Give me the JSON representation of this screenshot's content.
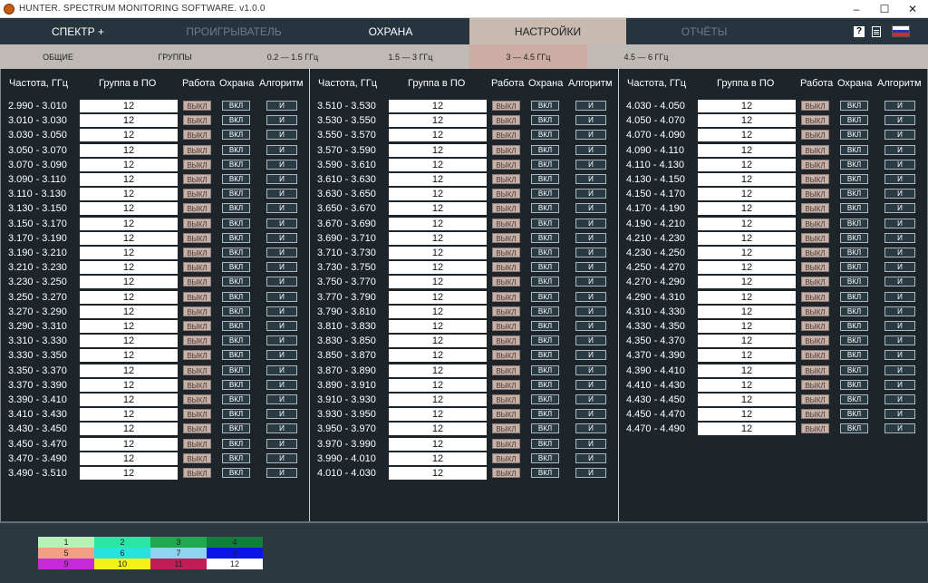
{
  "window": {
    "title": "HUNTER. SPECTRUM MONITORING SOFTWARE. v1.0.0",
    "controls": [
      "–",
      "☐",
      "✕"
    ]
  },
  "nav": {
    "tabs": [
      "СПЕКТР +",
      "ПРОИГРЫВАТЕЛЬ",
      "ОХРАНА",
      "НАСТРОЙКИ",
      "ОТЧЁТЫ"
    ],
    "active": "НАСТРОЙКИ",
    "help": "?"
  },
  "subnav": {
    "tabs": [
      "ОБЩИЕ",
      "ГРУППЫ",
      "0.2 — 1.5 ГГц",
      "1.5 — 3 ГГц",
      "3 — 4.5 ГГц",
      "4.5 — 6 ГГц"
    ],
    "active": "3 — 4.5 ГГц"
  },
  "table": {
    "headers": [
      "Частота, ГГц",
      "Группа в ПО",
      "Работа",
      "Охрана",
      "Алгоритм"
    ],
    "button_labels": {
      "work": "ВЫКЛ",
      "guard": "ВКЛ",
      "algorithm": "И"
    },
    "columns": [
      [
        {
          "freq": "2.990 - 3.010",
          "group": "12"
        },
        {
          "freq": "3.010 - 3.030",
          "group": "12"
        },
        {
          "freq": "3.030 - 3.050",
          "group": "12"
        },
        {
          "freq": "3.050 - 3.070",
          "group": "12"
        },
        {
          "freq": "3.070 - 3.090",
          "group": "12"
        },
        {
          "freq": "3.090 - 3.110",
          "group": "12"
        },
        {
          "freq": "3.110 - 3.130",
          "group": "12"
        },
        {
          "freq": "3.130 - 3.150",
          "group": "12"
        },
        {
          "freq": "3.150 - 3.170",
          "group": "12"
        },
        {
          "freq": "3.170 - 3.190",
          "group": "12"
        },
        {
          "freq": "3.190 - 3.210",
          "group": "12"
        },
        {
          "freq": "3.210 - 3.230",
          "group": "12"
        },
        {
          "freq": "3.230 - 3.250",
          "group": "12"
        },
        {
          "freq": "3.250 - 3.270",
          "group": "12"
        },
        {
          "freq": "3.270 - 3.290",
          "group": "12"
        },
        {
          "freq": "3.290 - 3.310",
          "group": "12"
        },
        {
          "freq": "3.310 - 3.330",
          "group": "12"
        },
        {
          "freq": "3.330 - 3.350",
          "group": "12"
        },
        {
          "freq": "3.350 - 3.370",
          "group": "12"
        },
        {
          "freq": "3.370 - 3.390",
          "group": "12"
        },
        {
          "freq": "3.390 - 3.410",
          "group": "12"
        },
        {
          "freq": "3.410 - 3.430",
          "group": "12"
        },
        {
          "freq": "3.430 - 3.450",
          "group": "12"
        },
        {
          "freq": "3.450 - 3.470",
          "group": "12"
        },
        {
          "freq": "3.470 - 3.490",
          "group": "12"
        },
        {
          "freq": "3.490 - 3.510",
          "group": "12"
        }
      ],
      [
        {
          "freq": "3.510 - 3.530",
          "group": "12"
        },
        {
          "freq": "3.530 - 3.550",
          "group": "12"
        },
        {
          "freq": "3.550 - 3.570",
          "group": "12"
        },
        {
          "freq": "3.570 - 3.590",
          "group": "12"
        },
        {
          "freq": "3.590 - 3.610",
          "group": "12"
        },
        {
          "freq": "3.610 - 3.630",
          "group": "12"
        },
        {
          "freq": "3.630 - 3.650",
          "group": "12"
        },
        {
          "freq": "3.650 - 3.670",
          "group": "12"
        },
        {
          "freq": "3.670 - 3.690",
          "group": "12"
        },
        {
          "freq": "3.690 - 3.710",
          "group": "12"
        },
        {
          "freq": "3.710 - 3.730",
          "group": "12"
        },
        {
          "freq": "3.730 - 3.750",
          "group": "12"
        },
        {
          "freq": "3.750 - 3.770",
          "group": "12"
        },
        {
          "freq": "3.770 - 3.790",
          "group": "12"
        },
        {
          "freq": "3.790 - 3.810",
          "group": "12"
        },
        {
          "freq": "3.810 - 3.830",
          "group": "12"
        },
        {
          "freq": "3.830 - 3.850",
          "group": "12"
        },
        {
          "freq": "3.850 - 3.870",
          "group": "12"
        },
        {
          "freq": "3.870 - 3.890",
          "group": "12"
        },
        {
          "freq": "3.890 - 3.910",
          "group": "12"
        },
        {
          "freq": "3.910 - 3.930",
          "group": "12"
        },
        {
          "freq": "3.930 - 3.950",
          "group": "12"
        },
        {
          "freq": "3.950 - 3.970",
          "group": "12"
        },
        {
          "freq": "3.970 - 3.990",
          "group": "12"
        },
        {
          "freq": "3.990 - 4.010",
          "group": "12"
        },
        {
          "freq": "4.010 - 4.030",
          "group": "12"
        }
      ],
      [
        {
          "freq": "4.030 - 4.050",
          "group": "12"
        },
        {
          "freq": "4.050 - 4.070",
          "group": "12"
        },
        {
          "freq": "4.070 - 4.090",
          "group": "12"
        },
        {
          "freq": "4.090 - 4.110",
          "group": "12"
        },
        {
          "freq": "4.110 - 4.130",
          "group": "12"
        },
        {
          "freq": "4.130 - 4.150",
          "group": "12"
        },
        {
          "freq": "4.150 - 4.170",
          "group": "12"
        },
        {
          "freq": "4.170 - 4.190",
          "group": "12"
        },
        {
          "freq": "4.190 - 4.210",
          "group": "12"
        },
        {
          "freq": "4.210 - 4.230",
          "group": "12"
        },
        {
          "freq": "4.230 - 4.250",
          "group": "12"
        },
        {
          "freq": "4.250 - 4.270",
          "group": "12"
        },
        {
          "freq": "4.270 - 4.290",
          "group": "12"
        },
        {
          "freq": "4.290 - 4.310",
          "group": "12"
        },
        {
          "freq": "4.310 - 4.330",
          "group": "12"
        },
        {
          "freq": "4.330 - 4.350",
          "group": "12"
        },
        {
          "freq": "4.350 - 4.370",
          "group": "12"
        },
        {
          "freq": "4.370 - 4.390",
          "group": "12"
        },
        {
          "freq": "4.390 - 4.410",
          "group": "12"
        },
        {
          "freq": "4.410 - 4.430",
          "group": "12"
        },
        {
          "freq": "4.430 - 4.450",
          "group": "12"
        },
        {
          "freq": "4.450 - 4.470",
          "group": "12"
        },
        {
          "freq": "4.470 - 4.490",
          "group": "12"
        }
      ]
    ]
  },
  "legend": [
    {
      "label": "1",
      "color": "#b6f2b6"
    },
    {
      "label": "2",
      "color": "#29e6a3"
    },
    {
      "label": "3",
      "color": "#1fa84c"
    },
    {
      "label": "4",
      "color": "#0f7f3a"
    },
    {
      "label": "5",
      "color": "#f2a083"
    },
    {
      "label": "6",
      "color": "#27e3e0"
    },
    {
      "label": "7",
      "color": "#8fd2f2"
    },
    {
      "label": "8",
      "color": "#0a16e8"
    },
    {
      "label": "9",
      "color": "#c52ad8"
    },
    {
      "label": "10",
      "color": "#f2f21a"
    },
    {
      "label": "11",
      "color": "#c21e56"
    },
    {
      "label": "12",
      "color": "#ffffff"
    }
  ],
  "colors": {
    "nav_bg": "#26343d",
    "nav_active": "#c9bab0",
    "subnav_bg": "#c0bab5",
    "subnav_active": "#cdaca3",
    "content_bg": "#1d252b",
    "off_button": "#c6b1a9",
    "flag": [
      "#ffffff",
      "#1c39bb",
      "#d52b1e"
    ]
  }
}
